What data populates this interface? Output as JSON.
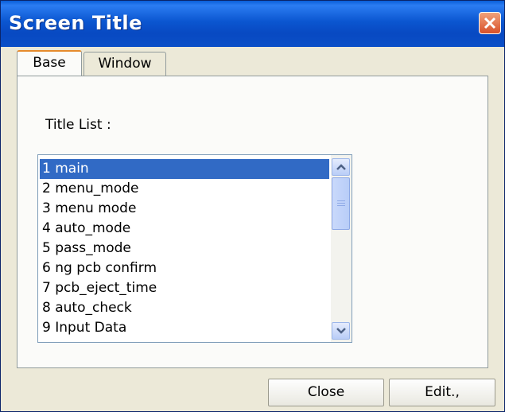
{
  "window": {
    "title": "Screen Title"
  },
  "tabs": [
    {
      "label": "Base",
      "active": true
    },
    {
      "label": "Window",
      "active": false
    }
  ],
  "title_list": {
    "label": "Title List :",
    "items": [
      "1 main",
      "2 menu_mode",
      "3 menu mode",
      "4 auto_mode",
      "5 pass_mode",
      "6 ng pcb confirm",
      "7 pcb_eject_time",
      "8 auto_check",
      "9 Input Data"
    ],
    "selected_index": 0
  },
  "buttons": {
    "close_label": "Close",
    "edit_label": "Edit.,"
  },
  "colors": {
    "title_bar": "#0a4fc7",
    "selection": "#316ac5",
    "dialog_bg": "#ece9d8",
    "close_button": "#d8502a"
  }
}
